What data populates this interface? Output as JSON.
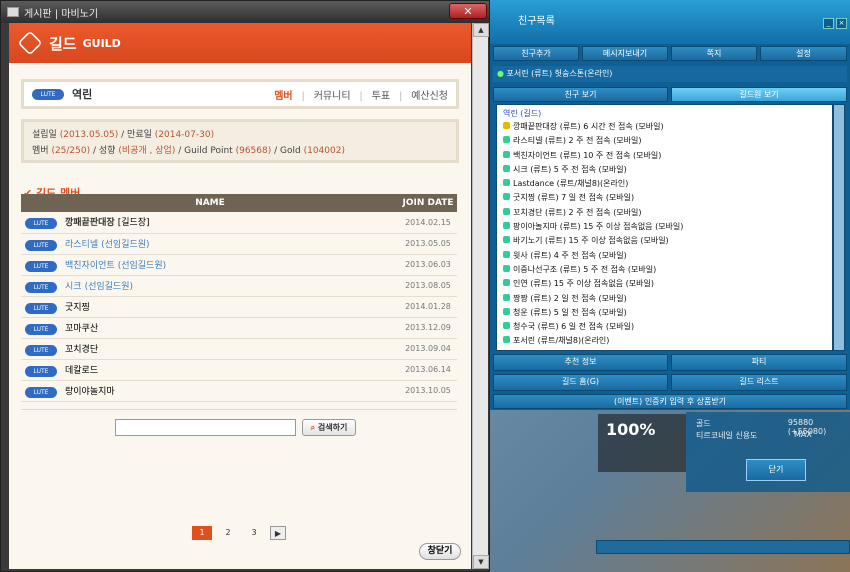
{
  "board_window": {
    "title": "게시판 | 마비노기",
    "close_glyph": "✕",
    "guild_header": {
      "title_kr": "길드",
      "title_en": "GUILD"
    },
    "guild_bar": {
      "server_badge": "LUTE",
      "guild_name": "역린",
      "menu": [
        "멤버",
        "커뮤니티",
        "투표",
        "예산신청"
      ]
    },
    "info": {
      "founded_label": "설립일",
      "founded": "(2013.05.05)",
      "expire_label": "만료일",
      "expire": "(2014-07-30)",
      "members_label": "멤버",
      "members": "(25/250)",
      "type_label": "성향",
      "type": "(비공개 , 상업)",
      "gp_label": "Guild Point",
      "gp": "(96568)",
      "gold_label": "Gold",
      "gold": "(104002)"
    },
    "section_title": "길드 멤버",
    "table": {
      "headers": [
        "NAME",
        "JOIN DATE"
      ],
      "rows": [
        {
          "badge": "LUTE",
          "name": "깡패끝판대장",
          "role": "[길드장]",
          "date": "2014.02.15",
          "style": "bold"
        },
        {
          "badge": "LUTE",
          "name": "라스티넬",
          "role": "(선임길드원)",
          "date": "2013.05.05",
          "style": "link"
        },
        {
          "badge": "LUTE",
          "name": "백친자이언트",
          "role": "(선임길드원)",
          "date": "2013.06.03",
          "style": "link"
        },
        {
          "badge": "LUTE",
          "name": "시크",
          "role": "(선임길드원)",
          "date": "2013.08.05",
          "style": "link"
        },
        {
          "badge": "LUTE",
          "name": "굿지찡",
          "role": "",
          "date": "2014.01.28",
          "style": "plain"
        },
        {
          "badge": "LUTE",
          "name": "꼬마쿠산",
          "role": "",
          "date": "2013.12.09",
          "style": "plain"
        },
        {
          "badge": "LUTE",
          "name": "꼬치경단",
          "role": "",
          "date": "2013.09.04",
          "style": "plain"
        },
        {
          "badge": "LUTE",
          "name": "데칼로드",
          "role": "",
          "date": "2013.06.14",
          "style": "plain"
        },
        {
          "badge": "LUTE",
          "name": "랑이야놀지마",
          "role": "",
          "date": "2013.10.05",
          "style": "plain"
        }
      ]
    },
    "search": {
      "placeholder": "",
      "button": "검색하기"
    },
    "pager": {
      "pages": [
        "1",
        "2",
        "3"
      ],
      "current": "1",
      "next": "▶"
    },
    "close_button": "창닫기"
  },
  "friends_window": {
    "title": "친구목록",
    "top_buttons": [
      "친구추가",
      "메시지보내기",
      "쪽지",
      "설정"
    ],
    "me_row": "포서린 (류트) 헛숭스톤(온라인)",
    "tabs": [
      "친구 보기",
      "길드원 보기"
    ],
    "selected_tab": "길드원 보기",
    "group_label": "역린 (길드)",
    "friends": [
      "깡패끝판대장 (류트) 6 시간 전 접속 (모바일)",
      "라스티넬 (류트) 2 주 전 접속 (모바일)",
      "백친자이언트 (류트) 10 주 전 접속 (모바일)",
      "시크 (류트) 5 주 전 접속 (모바일)",
      "Lastdance (류트/채널8)(온라인)",
      "굿지찡 (류트) 7 일 전 접속 (모바일)",
      "꼬치경단 (류트) 2 주 전 접속 (모바일)",
      "팡이아놀지마 (류트) 15 주 이상 접속없음 (모바일)",
      "바기노기 (류트) 15 주 이상 접속없음 (모바일)",
      "윗사 (류트) 4 주 전 접속 (모바일)",
      "이중나선구조 (류트) 5 주 전 접속 (모바일)",
      "인연 (류트) 15 주 이상 접속없음 (모바일)",
      "짱짱 (류트) 2 일 전 접속 (모바일)",
      "청운 (류트) 5 일 전 접속 (모바일)",
      "청수국 (류트) 6 일 전 접속 (모바일)",
      "포서린 (류트/채널8)(온라인)"
    ],
    "bottom_buttons": [
      [
        "추천 정보",
        "파티"
      ],
      [
        "길드 홈(G)",
        "길드 리스트"
      ],
      [
        "(이벤트) 인증키 입력 후 상품받기"
      ]
    ]
  },
  "hud": {
    "percent": "100%",
    "rows": [
      {
        "key": "골드",
        "value": "95880 (+55080)"
      },
      {
        "key": "티르코네일 신용도",
        "value": "MAX"
      }
    ],
    "close_button": "닫기"
  }
}
